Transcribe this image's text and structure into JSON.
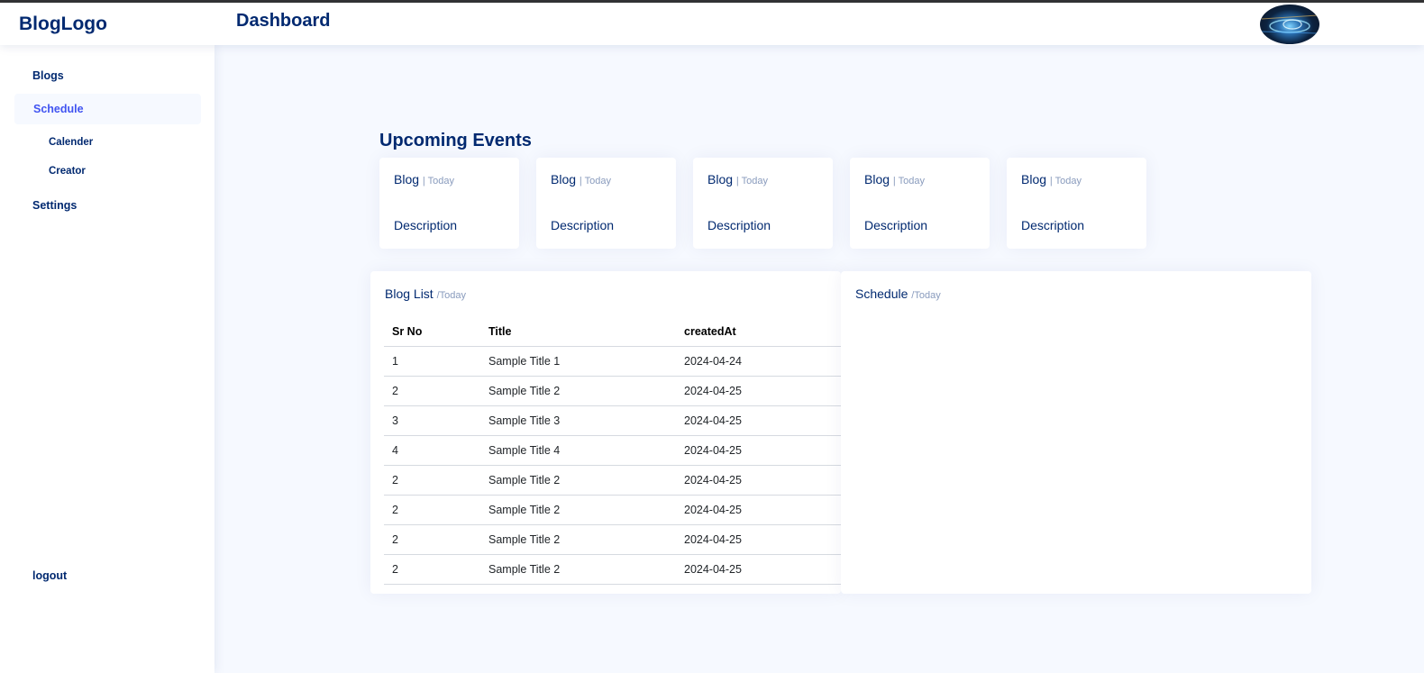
{
  "header": {
    "logo": "BlogLogo",
    "page_title": "Dashboard",
    "avatar_icon": "profile-avatar"
  },
  "sidebar": {
    "items": [
      {
        "label": "Blogs"
      },
      {
        "label": "Schedule"
      },
      {
        "label": "Calender"
      },
      {
        "label": "Creator"
      },
      {
        "label": "Settings"
      }
    ],
    "logout": "logout"
  },
  "upcoming_events": {
    "title": "Upcoming Events",
    "cards": [
      {
        "title": "Blog",
        "sub": "| Today",
        "description": "Description"
      },
      {
        "title": "Blog",
        "sub": "| Today",
        "description": "Description"
      },
      {
        "title": "Blog",
        "sub": "| Today",
        "description": "Description"
      },
      {
        "title": "Blog",
        "sub": "| Today",
        "description": "Description"
      },
      {
        "title": "Blog",
        "sub": "| Today",
        "description": "Description"
      }
    ]
  },
  "blog_list": {
    "title": "Blog List",
    "sub": "/Today",
    "columns": [
      "Sr No",
      "Title",
      "createdAt"
    ],
    "rows": [
      [
        "1",
        "Sample Title 1",
        "2024-04-24"
      ],
      [
        "2",
        "Sample Title 2",
        "2024-04-25"
      ],
      [
        "3",
        "Sample Title 3",
        "2024-04-25"
      ],
      [
        "4",
        "Sample Title 4",
        "2024-04-25"
      ],
      [
        "2",
        "Sample Title 2",
        "2024-04-25"
      ],
      [
        "2",
        "Sample Title 2",
        "2024-04-25"
      ],
      [
        "2",
        "Sample Title 2",
        "2024-04-25"
      ],
      [
        "2",
        "Sample Title 2",
        "2024-04-25"
      ]
    ]
  },
  "schedule": {
    "title": "Schedule",
    "sub": "/Today"
  },
  "colors": {
    "brand": "#012970",
    "accent": "#4154f1",
    "muted": "#899bbd",
    "background": "#f6f9ff"
  }
}
